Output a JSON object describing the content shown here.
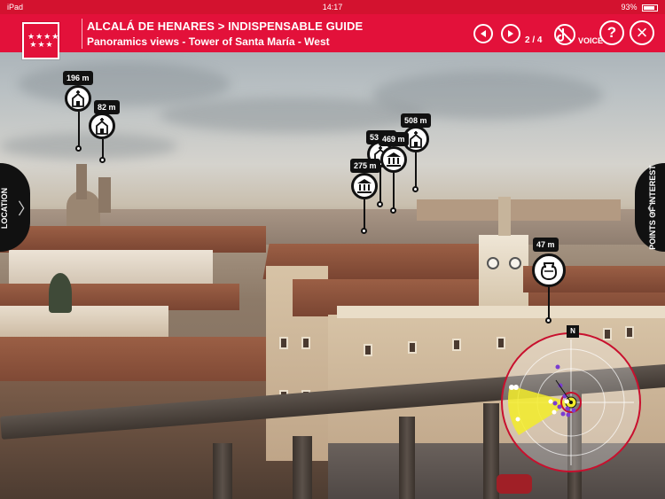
{
  "status_bar": {
    "carrier": "iPad",
    "time": "14:17",
    "battery": "93%"
  },
  "header": {
    "title": "ALCALÁ DE HENARES > INDISPENSABLE GUIDE",
    "subtitle": "Panoramics views - Tower of Santa María - West",
    "pager": "2 / 4",
    "voice_label": "VOICE",
    "help_label": "?",
    "close_label": "×",
    "colors": {
      "accent": "#e3113a",
      "status": "#d3122f"
    }
  },
  "side_tabs": {
    "left_label": "LOCATION",
    "right_label": "POINTS OF INTEREST"
  },
  "markers": [
    {
      "distance": "196 m",
      "icon": "church-icon"
    },
    {
      "distance": "82 m",
      "icon": "church-icon"
    },
    {
      "distance": "275 m",
      "icon": "museum-icon"
    },
    {
      "distance": "537 m",
      "icon": "church-icon"
    },
    {
      "distance": "469 m",
      "icon": "museum-icon"
    },
    {
      "distance": "508 m",
      "icon": "church-icon"
    },
    {
      "distance": "47 m",
      "icon": "urn-icon"
    }
  ],
  "radar": {
    "north_label": "N"
  }
}
